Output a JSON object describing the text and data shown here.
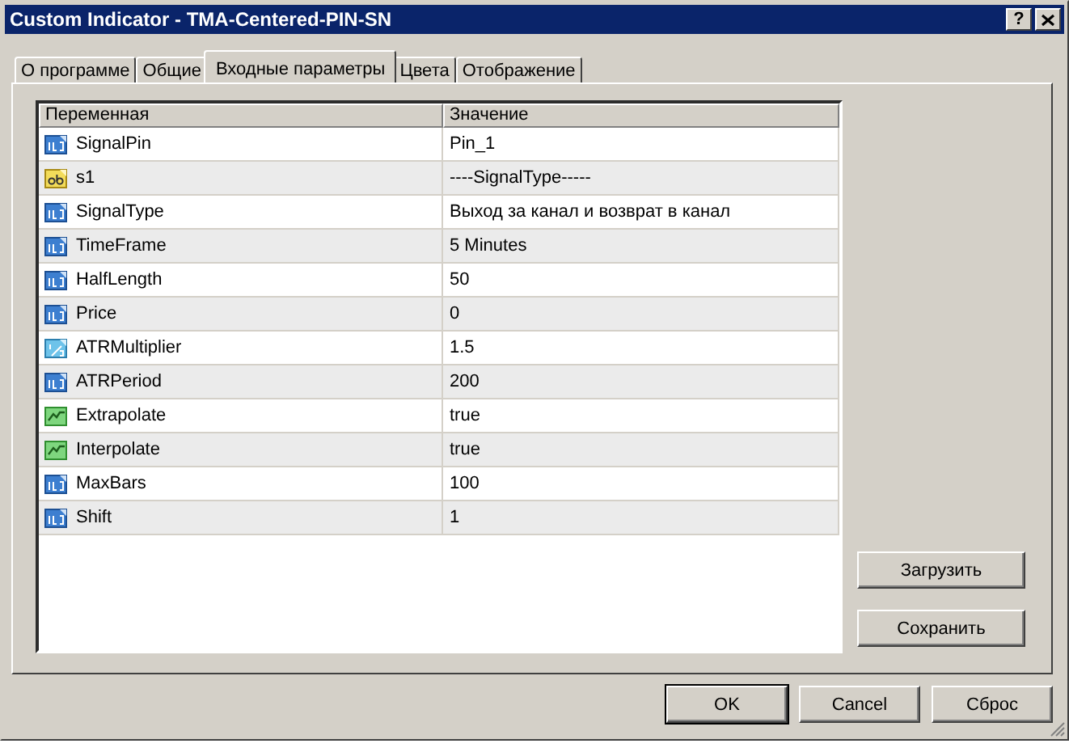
{
  "window": {
    "title": "Custom Indicator - TMA-Centered-PIN-SN",
    "help_button": "?"
  },
  "tabs": [
    {
      "label": "О программе",
      "selected": false
    },
    {
      "label": "Общие",
      "selected": false
    },
    {
      "label": "Входные параметры",
      "selected": true
    },
    {
      "label": "Цвета",
      "selected": false
    },
    {
      "label": "Отображение",
      "selected": false
    }
  ],
  "table": {
    "columns": [
      "Переменная",
      "Значение"
    ],
    "rows": [
      {
        "kind": "int",
        "name": "SignalPin",
        "value": "Pin_1"
      },
      {
        "kind": "string",
        "name": "s1",
        "value": "----SignalType-----"
      },
      {
        "kind": "int",
        "name": "SignalType",
        "value": "Выход за канал и возврат в канал"
      },
      {
        "kind": "int",
        "name": "TimeFrame",
        "value": "5 Minutes"
      },
      {
        "kind": "int",
        "name": "HalfLength",
        "value": "50"
      },
      {
        "kind": "int",
        "name": "Price",
        "value": "0"
      },
      {
        "kind": "double",
        "name": "ATRMultiplier",
        "value": "1.5"
      },
      {
        "kind": "int",
        "name": "ATRPeriod",
        "value": "200"
      },
      {
        "kind": "bool",
        "name": "Extrapolate",
        "value": "true"
      },
      {
        "kind": "bool",
        "name": "Interpolate",
        "value": "true"
      },
      {
        "kind": "int",
        "name": "MaxBars",
        "value": "100"
      },
      {
        "kind": "int",
        "name": "Shift",
        "value": "1"
      }
    ]
  },
  "side_buttons": [
    "Загрузить",
    "Сохранить"
  ],
  "buttons": [
    {
      "label": "OK",
      "default": true
    },
    {
      "label": "Cancel",
      "default": false
    },
    {
      "label": "Сброс",
      "default": false
    }
  ]
}
